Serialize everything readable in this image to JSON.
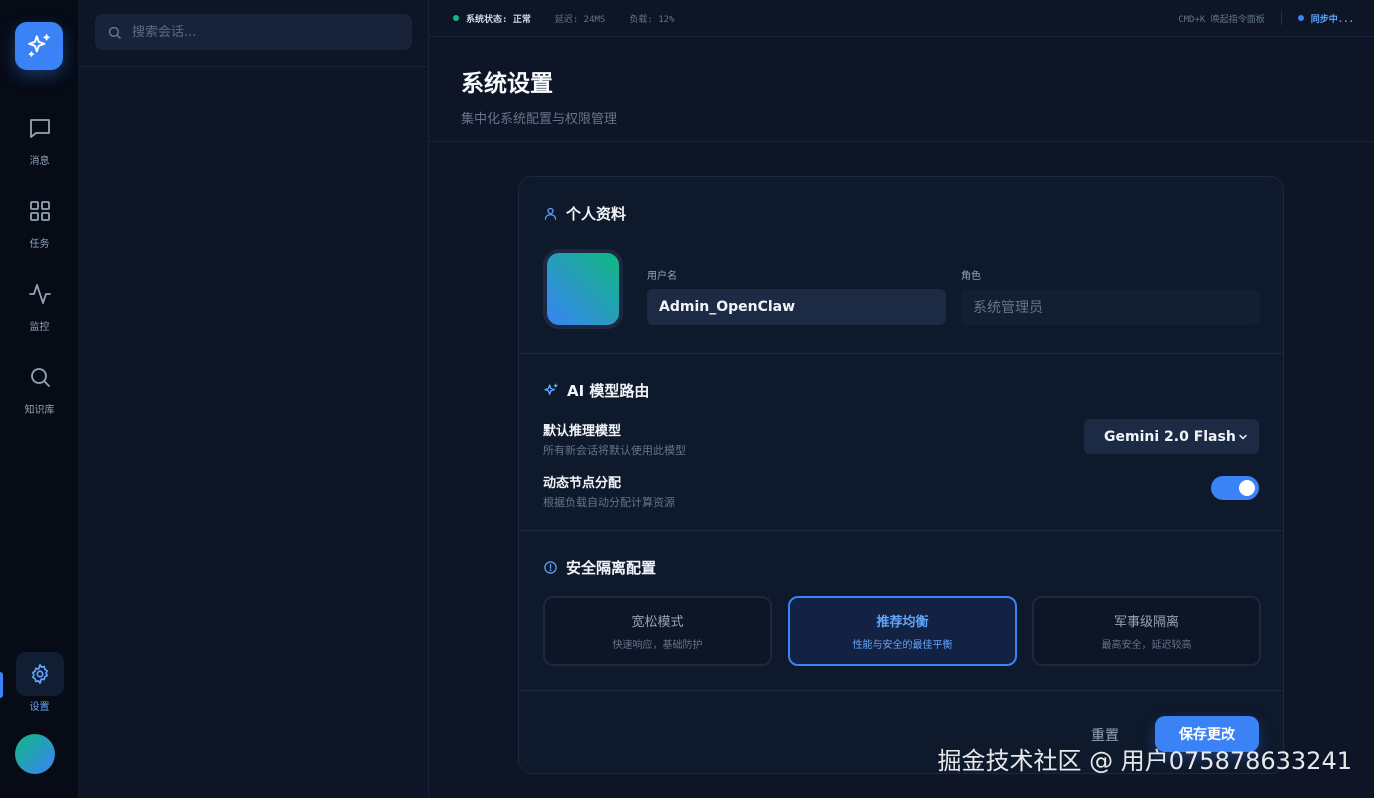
{
  "rail": {
    "items": [
      {
        "label": "消息",
        "icon": "message-icon"
      },
      {
        "label": "任务",
        "icon": "grid-icon"
      },
      {
        "label": "监控",
        "icon": "activity-icon"
      },
      {
        "label": "知识库",
        "icon": "search-icon"
      }
    ],
    "settings_label": "设置"
  },
  "conversations": {
    "search_placeholder": "搜索会话..."
  },
  "statusbar": {
    "status": "系统状态: 正常",
    "latency": "延迟: 24MS",
    "load": "负载: 12%",
    "shortcut": "CMD+K 唤起指令面板",
    "sync": "同步中..."
  },
  "page": {
    "title": "系统设置",
    "subtitle": "集中化系统配置与权限管理"
  },
  "profile": {
    "title": "个人资料",
    "username_label": "用户名",
    "username_value": "Admin_OpenClaw",
    "role_label": "角色",
    "role_value": "系统管理员"
  },
  "routing": {
    "title": "AI 模型路由",
    "default_model_label": "默认推理模型",
    "default_model_desc": "所有新会话将默认使用此模型",
    "selected_model": "Gemini 2.0 Flash",
    "dynamic_label": "动态节点分配",
    "dynamic_desc": "根据负载自动分配计算资源",
    "dynamic_enabled": true
  },
  "security": {
    "title": "安全隔离配置",
    "options": [
      {
        "title": "宽松模式",
        "desc": "快速响应，基础防护"
      },
      {
        "title": "推荐均衡",
        "desc": "性能与安全的最佳平衡"
      },
      {
        "title": "军事级隔离",
        "desc": "最高安全，延迟较高"
      }
    ],
    "selected_index": 1
  },
  "actions": {
    "reset": "重置",
    "save": "保存更改"
  },
  "watermark": "掘金技术社区 @ 用户075878633241",
  "colors": {
    "accent": "#3b82f6",
    "status_ok": "#10b981"
  }
}
